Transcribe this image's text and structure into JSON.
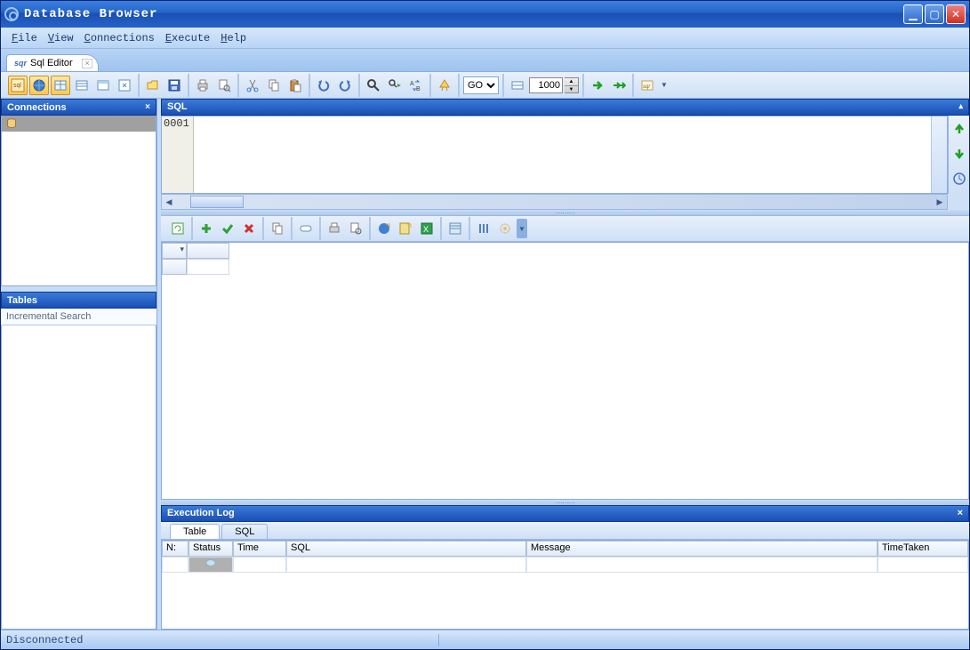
{
  "title": "Database Browser",
  "menu": {
    "file": "File",
    "view": "View",
    "connections": "Connections",
    "execute": "Execute",
    "help": "Help"
  },
  "tab": {
    "label": "Sql Editor"
  },
  "toolbar": {
    "go_option": "GO",
    "limit_value": "1000"
  },
  "panels": {
    "connections": "Connections",
    "tables": "Tables",
    "incsearch": "Incremental Search",
    "sql": "SQL",
    "execlog": "Execution Log"
  },
  "sql": {
    "line1": "0001"
  },
  "log": {
    "tabs": {
      "table": "Table",
      "sql": "SQL"
    },
    "cols": {
      "n": "N:",
      "status": "Status",
      "time": "Time",
      "sql": "SQL",
      "message": "Message",
      "timetaken": "TimeTaken"
    }
  },
  "status": "Disconnected"
}
